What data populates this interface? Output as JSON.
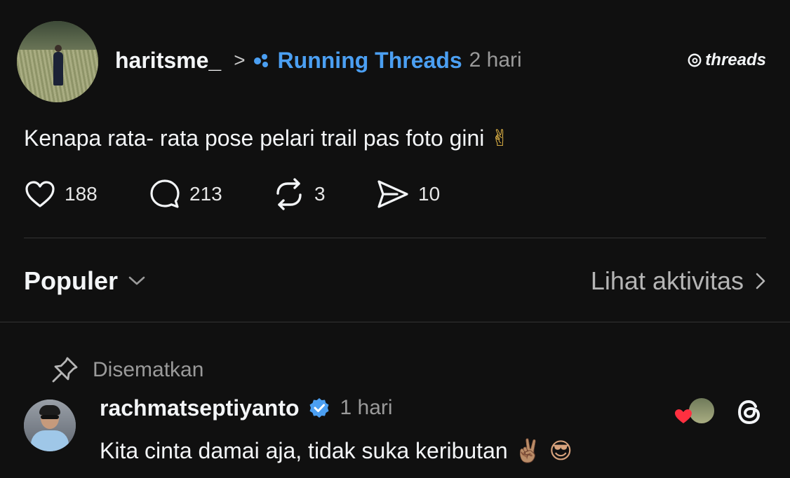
{
  "post": {
    "username": "haritsme_",
    "separator": ">",
    "community": "Running Threads",
    "time": "2 hari",
    "brand": "threads",
    "text": "Kenapa rata- rata pose pelari trail pas foto gini",
    "text_emoji": "✌",
    "stats": {
      "likes": "188",
      "replies": "213",
      "reposts": "3",
      "shares": "10"
    },
    "icons": {
      "like": "heart-icon",
      "reply": "comment-icon",
      "repost": "repost-icon",
      "share": "send-icon",
      "community": "community-dots-icon"
    }
  },
  "controls": {
    "sort_label": "Populer",
    "activity_label": "Lihat aktivitas"
  },
  "reply": {
    "pinned_label": "Disematkan",
    "username": "rachmatseptiyanto",
    "time": "1 hari",
    "text": "Kita cinta damai aja, tidak suka keributan",
    "emojis": "✌🏽 😎",
    "verified": true
  },
  "colors": {
    "background": "#101010",
    "accent": "#4b9ff2",
    "text": "#f3f5f7",
    "muted": "#9a9a9a",
    "heart": "#ff3040"
  }
}
